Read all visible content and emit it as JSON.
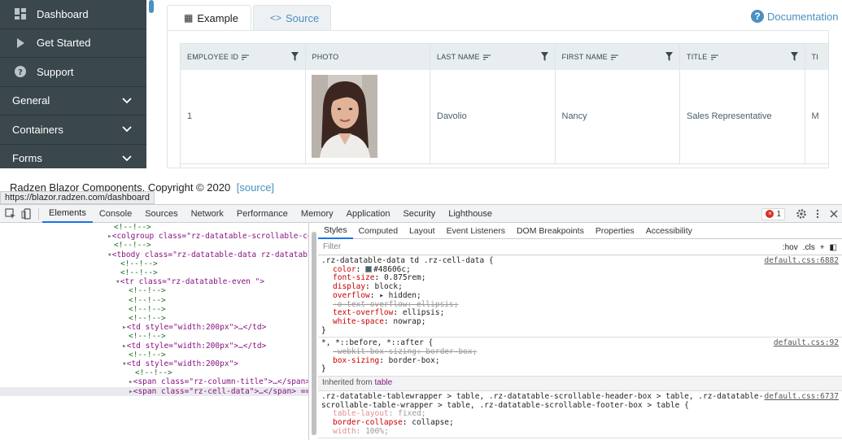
{
  "sidebar": {
    "items": [
      {
        "label": "Dashboard",
        "icon": "dashboard-icon"
      },
      {
        "label": "Get Started",
        "icon": "play-icon"
      },
      {
        "label": "Support",
        "icon": "help-icon"
      },
      {
        "label": "General",
        "icon": "chevron-down-icon"
      },
      {
        "label": "Containers",
        "icon": "chevron-down-icon"
      },
      {
        "label": "Forms",
        "icon": "chevron-down-icon"
      }
    ]
  },
  "tabs": [
    {
      "label": "Example",
      "icon": "grid-icon"
    },
    {
      "label": "Source",
      "icon": "code-icon"
    }
  ],
  "documentation": {
    "label": "Documentation",
    "icon": "help-circle-icon"
  },
  "grid": {
    "columns": [
      "EMPLOYEE ID",
      "PHOTO",
      "LAST NAME",
      "FIRST NAME",
      "TITLE",
      "TI"
    ],
    "rows": [
      {
        "employee_id": "1",
        "last_name": "Davolio",
        "first_name": "Nancy",
        "title": "Sales Representative",
        "extra": "M"
      }
    ]
  },
  "footer": {
    "text": "Radzen Blazor Components, Copyright © 2020",
    "source_link": "[source]"
  },
  "url_tooltip": "https://blazor.radzen.com/dashboard",
  "devtools": {
    "tabs": [
      "Elements",
      "Console",
      "Sources",
      "Network",
      "Performance",
      "Memory",
      "Application",
      "Security",
      "Lighthouse"
    ],
    "error_count": "1",
    "elements": [
      "<!--!-->",
      "<colgroup class=\"rz-datatable-scrollable-colgroup\">…</colgroup>",
      "<!--!-->",
      "<tbody class=\"rz-datatable-data  rz-datatable-hoverable-rows\">",
      "<!--!-->",
      "<!--!-->",
      "<tr class=\"rz-datatable-even \">",
      "<!--!-->",
      "<!--!-->",
      "<!--!-->",
      "<!--!-->",
      "<td style=\"width:200px\">…</td>",
      "<!--!-->",
      "<td style=\"width:200px\">…</td>",
      "<!--!-->",
      "<td style=\"width:200px\">",
      "<!--!-->",
      "<span class=\"rz-column-title\">…</span>",
      "<span class=\"rz-cell-data\">…</span> == $0"
    ],
    "style_tabs": [
      "Styles",
      "Computed",
      "Layout",
      "Event Listeners",
      "DOM Breakpoints",
      "Properties",
      "Accessibility"
    ],
    "filter_placeholder": "Filter",
    "hov": ":hov",
    "cls": ".cls",
    "rules": [
      {
        "selector": ".rz-datatable-data td .rz-cell-data {",
        "source": "default.css:6882",
        "props": [
          {
            "name": "color",
            "value": "#48606c;",
            "struck": false,
            "swatch": "#48606c"
          },
          {
            "name": "font-size",
            "value": "0.875rem;",
            "struck": false
          },
          {
            "name": "display",
            "value": "block;",
            "struck": false
          },
          {
            "name": "overflow",
            "value": "▸ hidden;",
            "struck": false
          },
          {
            "name": "-o-text-overflow",
            "value": "ellipsis;",
            "struck": true
          },
          {
            "name": "text-overflow",
            "value": "ellipsis;",
            "struck": false
          },
          {
            "name": "white-space",
            "value": "nowrap;",
            "struck": false
          }
        ]
      },
      {
        "selector": "*, *::before, *::after {",
        "source": "default.css:92",
        "props": [
          {
            "name": "-webkit-box-sizing",
            "value": "border-box;",
            "struck": true
          },
          {
            "name": "box-sizing",
            "value": "border-box;",
            "struck": false
          }
        ]
      }
    ],
    "inherited_label": "Inherited from",
    "inherited_tag": "table",
    "inherited_rule": {
      "selector": ".rz-datatable-tablewrapper > table, .rz-datatable-scrollable-header-box > table, .rz-datatable-scrollable-table-wrapper > table, .rz-datatable-scrollable-footer-box > table {",
      "source": "default.css:6737",
      "props": [
        {
          "name": "table-layout",
          "value": "fixed;",
          "dim": true
        },
        {
          "name": "border-collapse",
          "value": "collapse;",
          "dim": false
        },
        {
          "name": "width",
          "value": "100%;",
          "dim": true
        }
      ]
    }
  }
}
